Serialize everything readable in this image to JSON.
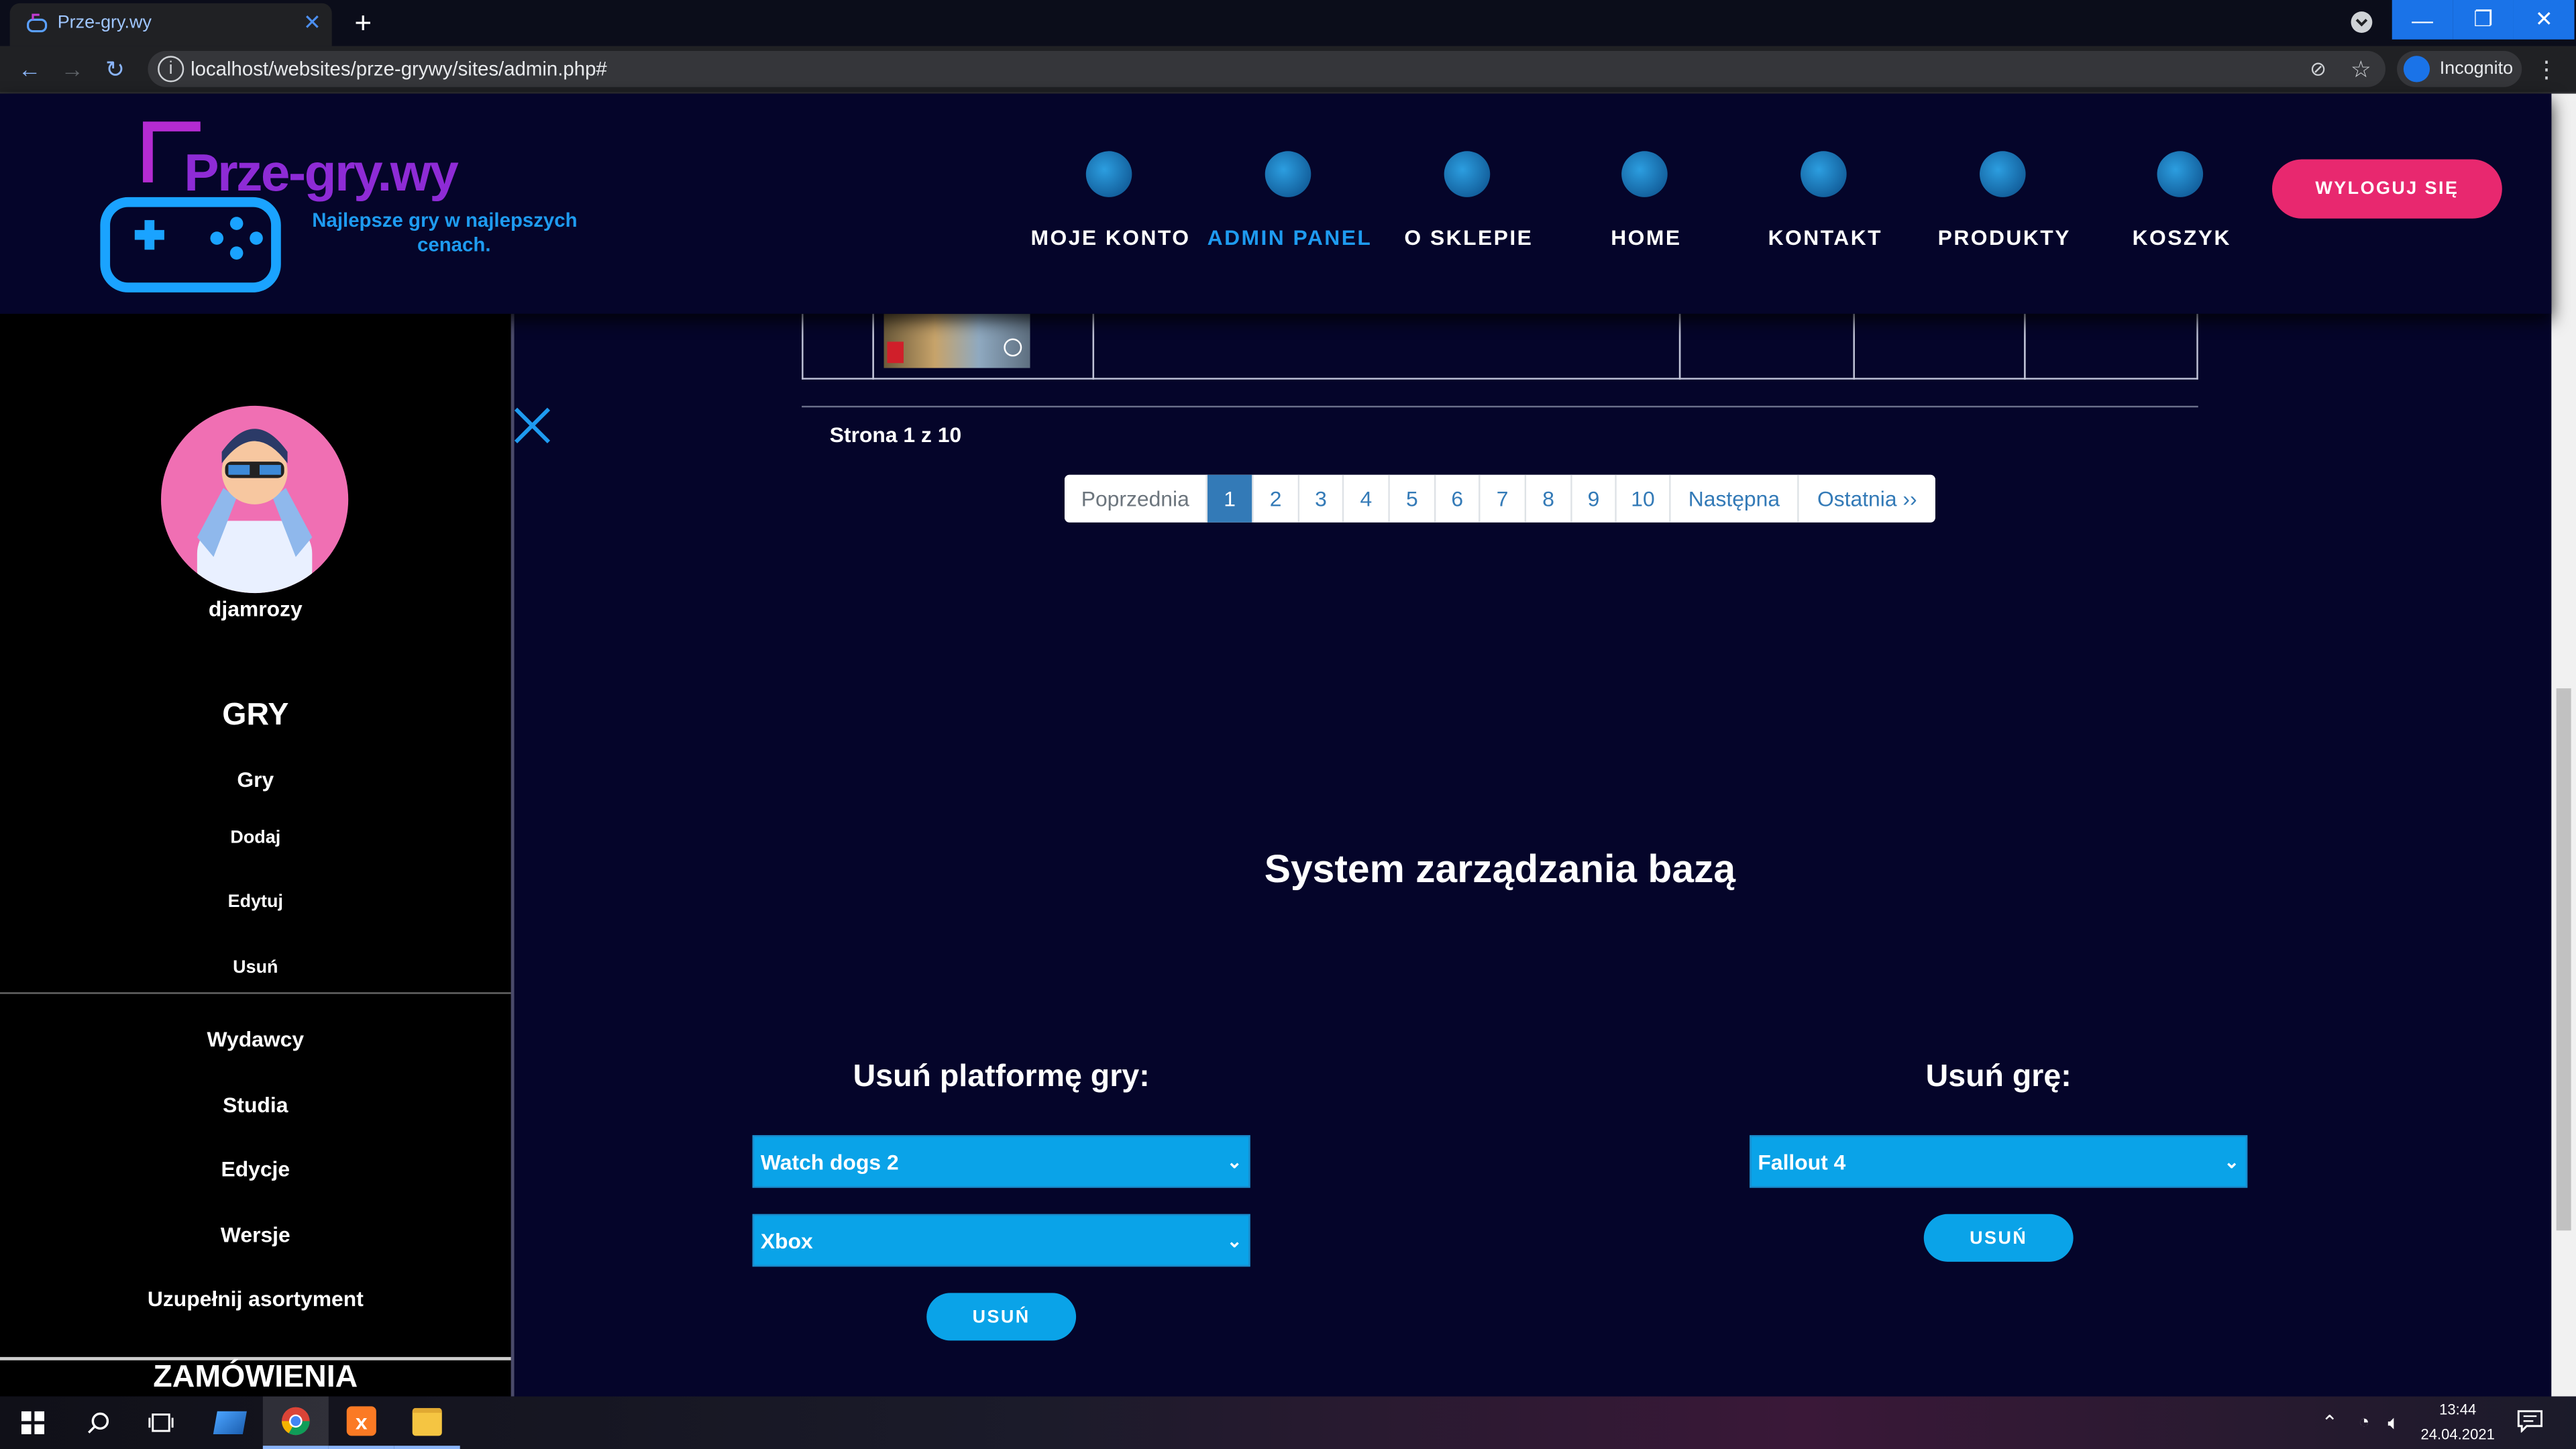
{
  "browser": {
    "tab_title": "Prze-gry.wy",
    "url": "localhost/websites/prze-grywy/sites/admin.php#",
    "profile_label": "Incognito"
  },
  "header": {
    "logo_title": "Prze-gry.wy",
    "tagline_line1": "Najlepsze gry w najlepszych",
    "tagline_line2": "cenach.",
    "nav": [
      {
        "label": "MOJE KONTO",
        "icon": "account-icon"
      },
      {
        "label": "ADMIN PANEL",
        "icon": "admin-icon"
      },
      {
        "label": "O SKLEPIE",
        "icon": "about-icon"
      },
      {
        "label": "HOME",
        "icon": "home-icon"
      },
      {
        "label": "KONTAKT",
        "icon": "contact-icon"
      },
      {
        "label": "PRODUKTY",
        "icon": "products-icon"
      },
      {
        "label": "KOSZYK",
        "icon": "cart-icon"
      }
    ],
    "logout_label": "WYLOGUJ SIĘ"
  },
  "sidebar": {
    "username": "djamrozy",
    "section_games": "GRY",
    "games_items": [
      "Gry",
      "Dodaj",
      "Edytuj",
      "Usuń"
    ],
    "other_items": [
      "Wydawcy",
      "Studia",
      "Edycje",
      "Wersje",
      "Uzupełnij asortyment"
    ],
    "section_orders": "ZAMÓWIENIA"
  },
  "pagination": {
    "page_info": "Strona 1 z 10",
    "prev": "Poprzednia",
    "pages": [
      "1",
      "2",
      "3",
      "4",
      "5",
      "6",
      "7",
      "8",
      "9",
      "10"
    ],
    "active_page": "1",
    "next": "Następna",
    "last": "Ostatnia ››"
  },
  "main": {
    "heading": "System zarządzania bazą",
    "remove_platform": {
      "title": "Usuń platformę gry:",
      "game_select": "Watch dogs 2",
      "platform_select": "Xbox",
      "button": "USUŃ"
    },
    "remove_game": {
      "title": "Usuń grę:",
      "game_select": "Fallout 4",
      "button": "USUŃ"
    }
  },
  "taskbar": {
    "time": "13:44",
    "date": "24.04.2021"
  },
  "colors": {
    "accent_blue": "#0aa3e8",
    "logout_pink": "#e8286f",
    "page_bg": "#05052a",
    "active_nav": "#1e9bf0"
  }
}
